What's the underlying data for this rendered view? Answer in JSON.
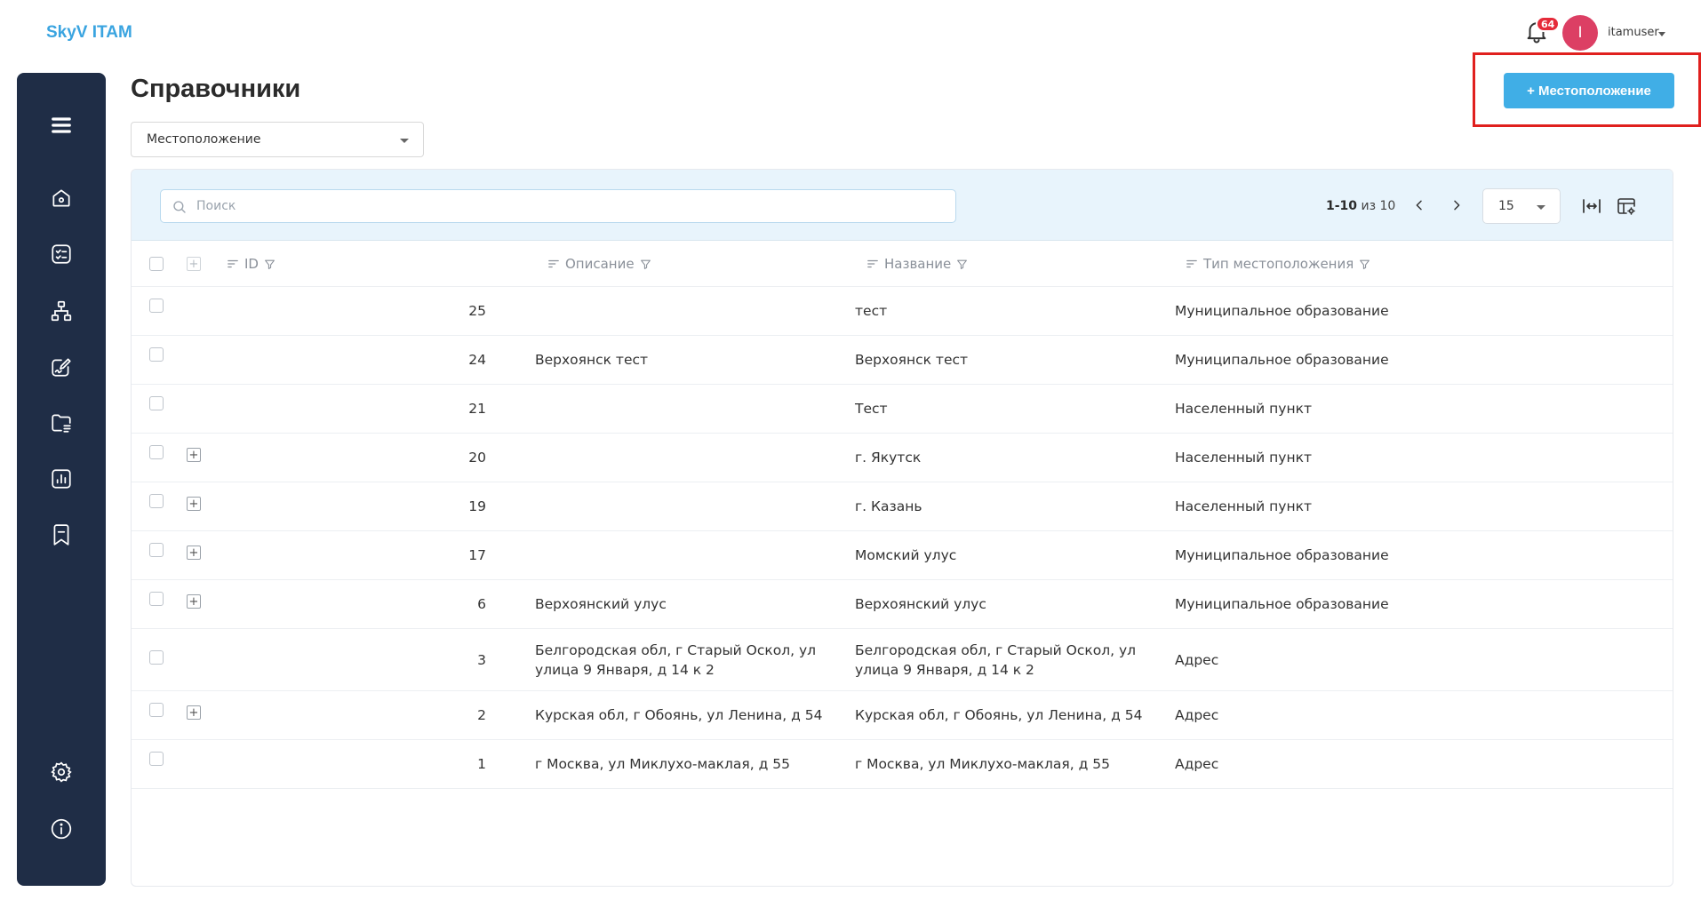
{
  "app": {
    "brand": "SkyV ITAM"
  },
  "header": {
    "notifications": "64",
    "avatar_letter": "I",
    "username": "itamuser"
  },
  "page": {
    "title": "Справочники",
    "add_button": "+ Местоположение",
    "directory_select": "Местоположение"
  },
  "toolbar": {
    "search_placeholder": "Поиск",
    "range": "1-10",
    "of_total": "из 10",
    "page_size": "15"
  },
  "columns": {
    "id": "ID",
    "description": "Описание",
    "name": "Название",
    "type": "Тип местоположения"
  },
  "rows": [
    {
      "id": "25",
      "description": "",
      "name": "тест",
      "type": "Муниципальное образование",
      "expandable": false
    },
    {
      "id": "24",
      "description": "Верхоянск тест",
      "name": "Верхоянск тест",
      "type": "Муниципальное образование",
      "expandable": false
    },
    {
      "id": "21",
      "description": "",
      "name": "Тест",
      "type": "Населенный пункт",
      "expandable": false
    },
    {
      "id": "20",
      "description": "",
      "name": "г. Якутск",
      "type": "Населенный пункт",
      "expandable": true
    },
    {
      "id": "19",
      "description": "",
      "name": "г. Казань",
      "type": "Населенный пункт",
      "expandable": true
    },
    {
      "id": "17",
      "description": "",
      "name": "Момский улус",
      "type": "Муниципальное образование",
      "expandable": true
    },
    {
      "id": "6",
      "description": "Верхоянский улус",
      "name": "Верхоянский улус",
      "type": "Муниципальное образование",
      "expandable": true
    },
    {
      "id": "3",
      "description": "Белгородская обл, г Старый Оскол, ул улица 9 Января, д 14 к 2",
      "name": "Белгородская обл, г Старый Оскол, ул улица 9 Января, д 14 к 2",
      "type": "Адрес",
      "expandable": false
    },
    {
      "id": "2",
      "description": "Курская обл, г Обоянь, ул Ленина, д 54",
      "name": "Курская обл, г Обоянь, ул Ленина, д 54",
      "type": "Адрес",
      "expandable": true
    },
    {
      "id": "1",
      "description": "г Москва, ул Миклухо-маклая, д 55",
      "name": "г Москва, ул Миклухо-маклая, д 55",
      "type": "Адрес",
      "expandable": false
    }
  ],
  "colors": {
    "accent": "#40aee6",
    "sidebar": "#1f2d46",
    "highlight": "#e0201e",
    "badge": "#e52b3a",
    "avatar": "#dc3f64"
  }
}
